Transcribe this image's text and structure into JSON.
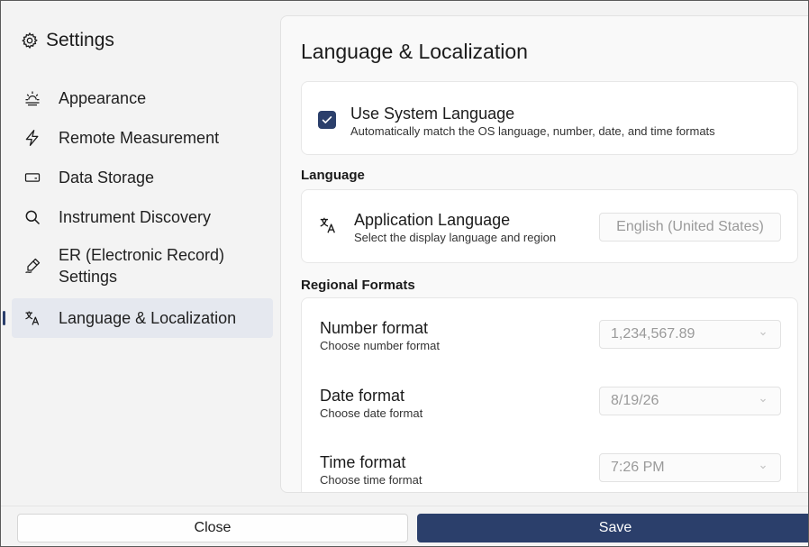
{
  "sidebar": {
    "title": "Settings",
    "items": [
      {
        "label": "Appearance",
        "icon": "sunrise-icon"
      },
      {
        "label": "Remote Measurement",
        "icon": "lightning-icon"
      },
      {
        "label": "Data Storage",
        "icon": "drive-icon"
      },
      {
        "label": "Instrument Discovery",
        "icon": "search-icon"
      },
      {
        "label": "ER (Electronic Record) Settings",
        "icon": "signature-icon"
      },
      {
        "label": "Language & Localization",
        "icon": "translate-icon",
        "active": true
      }
    ]
  },
  "main": {
    "title": "Language & Localization",
    "system_language": {
      "checked": true,
      "title": "Use System Language",
      "subtitle": "Automatically match the OS language, number, date, and time formats"
    },
    "language_section": {
      "label": "Language",
      "app_language": {
        "title": "Application Language",
        "subtitle": "Select the display language and region",
        "value": "English (United States)"
      }
    },
    "regional_section": {
      "label": "Regional Formats",
      "rows": [
        {
          "title": "Number format",
          "subtitle": "Choose number format",
          "value": "1,234,567.89"
        },
        {
          "title": "Date format",
          "subtitle": "Choose date format",
          "value": "8/19/26"
        },
        {
          "title": "Time format",
          "subtitle": "Choose time format",
          "value": "7:26 PM"
        }
      ]
    }
  },
  "footer": {
    "close_label": "Close",
    "save_label": "Save"
  },
  "colors": {
    "accent": "#2b3f6b",
    "sidebar_bg": "#f3f3f3",
    "active_item_bg": "#e5e8ef"
  }
}
